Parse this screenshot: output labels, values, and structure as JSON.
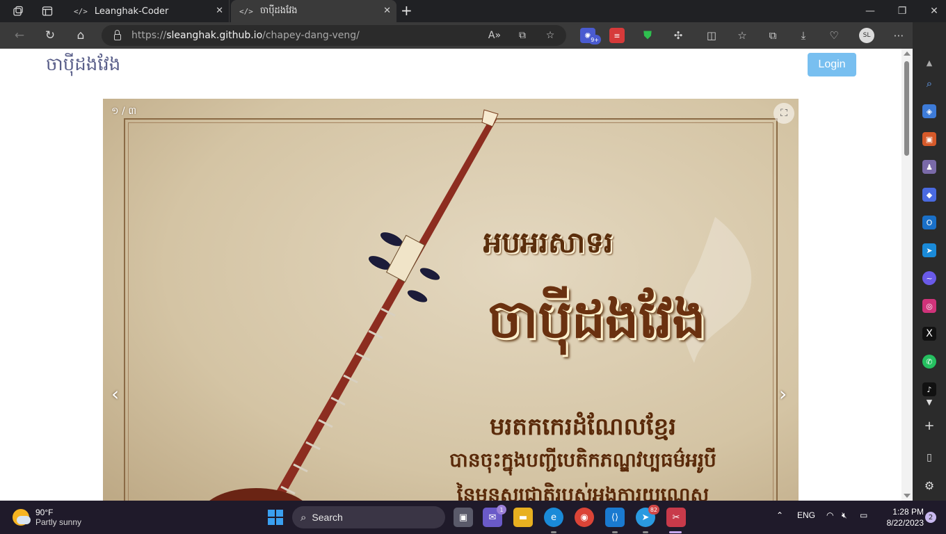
{
  "browser": {
    "tabs": [
      {
        "title": "Leanghak-Coder",
        "icon": "code-icon"
      },
      {
        "title": "ចាប៉ីដងវែង",
        "icon": "code-icon"
      }
    ],
    "url_prefix": "https://",
    "url_domain": "sleanghak.github.io",
    "url_path": "/chapey-dang-veng/",
    "profile_initials": "SL",
    "extension_badge": "9+"
  },
  "page": {
    "site_title": "ចាប៉ីដងវែង",
    "login_label": "Login",
    "login_color": "#78bff0",
    "carousel": {
      "counter": "១ / ៣",
      "prev_symbol": "‹",
      "next_symbol": "›",
      "poster_lines": [
        "អបអរសាទរ",
        "ចាប៉ីដងវែង",
        "មរតកកេរដំណែលខ្មែរ",
        "បានចុះក្នុងបញ្ជីបេតិកភណ្ឌវប្បធម៌អរូបី",
        "នៃមនុស្សជាតិរបស់អង្គការយូណេស្កូ"
      ]
    }
  },
  "taskbar": {
    "weather_temp": "90°F",
    "weather_cond": "Partly sunny",
    "search_label": "Search",
    "teams_badge": "1",
    "telegram_badge": "82",
    "lang": "ENG",
    "time": "1:28 PM",
    "date": "8/22/2023",
    "notifications": "2"
  }
}
